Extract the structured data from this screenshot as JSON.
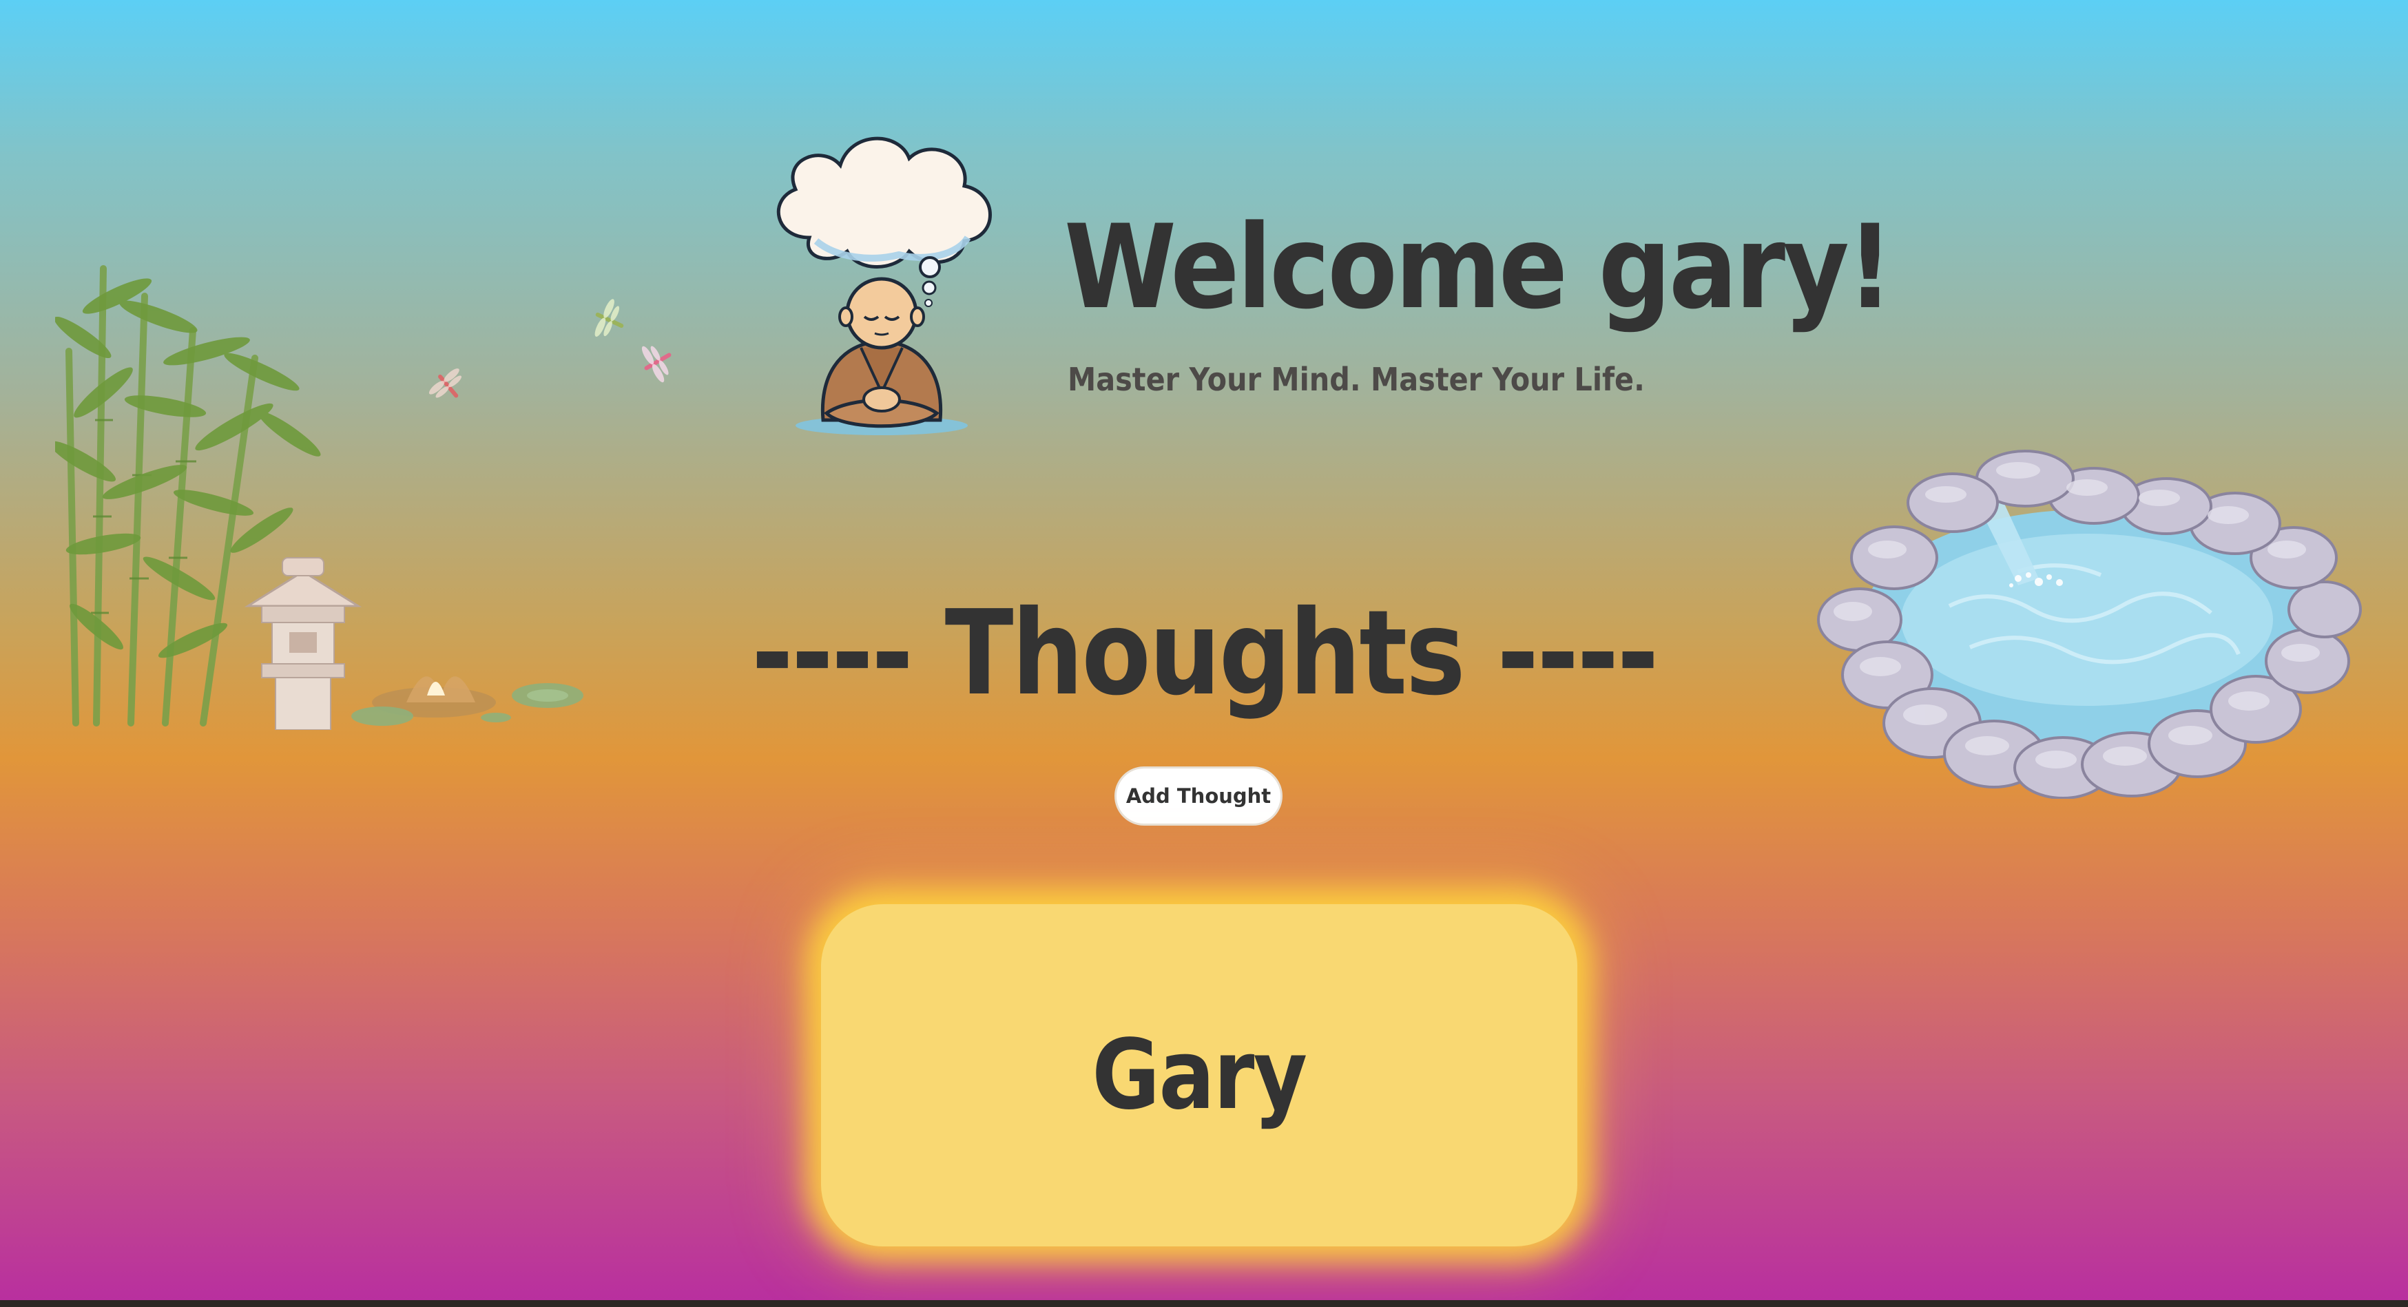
{
  "header": {
    "title": "Welcome gary!",
    "tagline": "Master Your Mind. Master Your Life."
  },
  "thoughts": {
    "heading": "---- Thoughts ----",
    "add_button_label": "Add Thought",
    "items": [
      {
        "title": "Gary"
      }
    ]
  },
  "illustrations": {
    "left": "bamboo-garden-illustration",
    "monk": "meditating-monk-illustration",
    "right": "rock-pond-illustration"
  },
  "colors": {
    "background_top": "#5ccff5",
    "background_mid": "#e1963a",
    "background_bottom": "#b82ea0",
    "card": "#f9d872",
    "text": "#333333"
  }
}
